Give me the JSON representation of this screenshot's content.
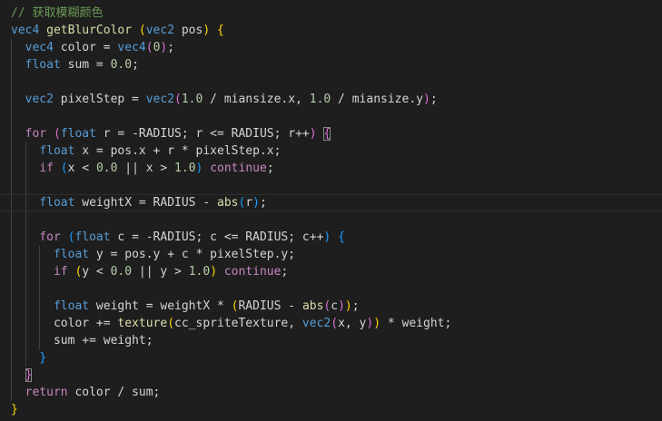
{
  "editor": {
    "language": "glsl",
    "colors": {
      "background": "#1e1e1e",
      "comment": "#6a9955",
      "type": "#569cd6",
      "keyword": "#c586c0",
      "function": "#dcdcaa",
      "number": "#b5cea8",
      "text": "#d4d4d4",
      "bracket_1": "#ffd700",
      "bracket_2": "#da70d6",
      "bracket_3": "#179fff"
    },
    "lines": [
      [
        [
          "comment",
          "// 获取模糊颜色"
        ]
      ],
      [
        [
          "type",
          "vec4"
        ],
        [
          "text",
          " "
        ],
        [
          "func",
          "getBlurColor"
        ],
        [
          "text",
          " "
        ],
        [
          "b1",
          "("
        ],
        [
          "type",
          "vec2"
        ],
        [
          "text",
          " pos"
        ],
        [
          "b1",
          ")"
        ],
        [
          "text",
          " "
        ],
        [
          "b1",
          "{"
        ]
      ],
      [
        [
          "text",
          "  "
        ],
        [
          "type",
          "vec4"
        ],
        [
          "text",
          " color = "
        ],
        [
          "type",
          "vec4"
        ],
        [
          "b2",
          "("
        ],
        [
          "num",
          "0"
        ],
        [
          "b2",
          ")"
        ],
        [
          "text",
          ";"
        ]
      ],
      [
        [
          "text",
          "  "
        ],
        [
          "type",
          "float"
        ],
        [
          "text",
          " sum = "
        ],
        [
          "num",
          "0.0"
        ],
        [
          "text",
          ";"
        ]
      ],
      [],
      [
        [
          "text",
          "  "
        ],
        [
          "type",
          "vec2"
        ],
        [
          "text",
          " pixelStep = "
        ],
        [
          "type",
          "vec2"
        ],
        [
          "b2",
          "("
        ],
        [
          "num",
          "1.0"
        ],
        [
          "text",
          " / miansize.x, "
        ],
        [
          "num",
          "1.0"
        ],
        [
          "text",
          " / miansize.y"
        ],
        [
          "b2",
          ")"
        ],
        [
          "text",
          ";"
        ]
      ],
      [],
      [
        [
          "text",
          "  "
        ],
        [
          "keyword",
          "for"
        ],
        [
          "text",
          " "
        ],
        [
          "b2",
          "("
        ],
        [
          "type",
          "float"
        ],
        [
          "text",
          " r = -RADIUS; r <= RADIUS; r++"
        ],
        [
          "b2",
          ")"
        ],
        [
          "text",
          " "
        ],
        [
          "b2m",
          "{"
        ]
      ],
      [
        [
          "text",
          "    "
        ],
        [
          "type",
          "float"
        ],
        [
          "text",
          " x = pos.x + r * pixelStep.x;"
        ]
      ],
      [
        [
          "text",
          "    "
        ],
        [
          "keyword",
          "if"
        ],
        [
          "text",
          " "
        ],
        [
          "b3",
          "("
        ],
        [
          "text",
          "x < "
        ],
        [
          "num",
          "0.0"
        ],
        [
          "text",
          " || x > "
        ],
        [
          "num",
          "1.0"
        ],
        [
          "b3",
          ")"
        ],
        [
          "text",
          " "
        ],
        [
          "keyword",
          "continue"
        ],
        [
          "text",
          ";"
        ]
      ],
      [],
      [
        [
          "text",
          "    "
        ],
        [
          "type",
          "float"
        ],
        [
          "text",
          " weightX = RADIUS - "
        ],
        [
          "func",
          "abs"
        ],
        [
          "b3",
          "("
        ],
        [
          "text",
          "r"
        ],
        [
          "b3",
          ")"
        ],
        [
          "text",
          ";"
        ]
      ],
      [],
      [
        [
          "text",
          "    "
        ],
        [
          "keyword",
          "for"
        ],
        [
          "text",
          " "
        ],
        [
          "b3",
          "("
        ],
        [
          "type",
          "float"
        ],
        [
          "text",
          " c = -RADIUS; c <= RADIUS; c++"
        ],
        [
          "b3",
          ")"
        ],
        [
          "text",
          " "
        ],
        [
          "b3",
          "{"
        ]
      ],
      [
        [
          "text",
          "      "
        ],
        [
          "type",
          "float"
        ],
        [
          "text",
          " y = pos.y + c * pixelStep.y;"
        ]
      ],
      [
        [
          "text",
          "      "
        ],
        [
          "keyword",
          "if"
        ],
        [
          "text",
          " "
        ],
        [
          "b1",
          "("
        ],
        [
          "text",
          "y < "
        ],
        [
          "num",
          "0.0"
        ],
        [
          "text",
          " || y > "
        ],
        [
          "num",
          "1.0"
        ],
        [
          "b1",
          ")"
        ],
        [
          "text",
          " "
        ],
        [
          "keyword",
          "continue"
        ],
        [
          "text",
          ";"
        ]
      ],
      [],
      [
        [
          "text",
          "      "
        ],
        [
          "type",
          "float"
        ],
        [
          "text",
          " weight = weightX * "
        ],
        [
          "b1",
          "("
        ],
        [
          "text",
          "RADIUS - "
        ],
        [
          "func",
          "abs"
        ],
        [
          "b2",
          "("
        ],
        [
          "text",
          "c"
        ],
        [
          "b2",
          ")"
        ],
        [
          "b1",
          ")"
        ],
        [
          "text",
          ";"
        ]
      ],
      [
        [
          "text",
          "      color += "
        ],
        [
          "func",
          "texture"
        ],
        [
          "b1",
          "("
        ],
        [
          "text",
          "cc_spriteTexture, "
        ],
        [
          "type",
          "vec2"
        ],
        [
          "b2",
          "("
        ],
        [
          "text",
          "x, y"
        ],
        [
          "b2",
          ")"
        ],
        [
          "b1",
          ")"
        ],
        [
          "text",
          " * weight;"
        ]
      ],
      [
        [
          "text",
          "      sum += weight;"
        ]
      ],
      [
        [
          "text",
          "    "
        ],
        [
          "b3",
          "}"
        ]
      ],
      [
        [
          "text",
          "  "
        ],
        [
          "b2m",
          "}"
        ]
      ],
      [
        [
          "text",
          "  "
        ],
        [
          "keyword",
          "return"
        ],
        [
          "text",
          " color / sum;"
        ]
      ],
      [
        [
          "b1",
          "}"
        ]
      ]
    ]
  }
}
